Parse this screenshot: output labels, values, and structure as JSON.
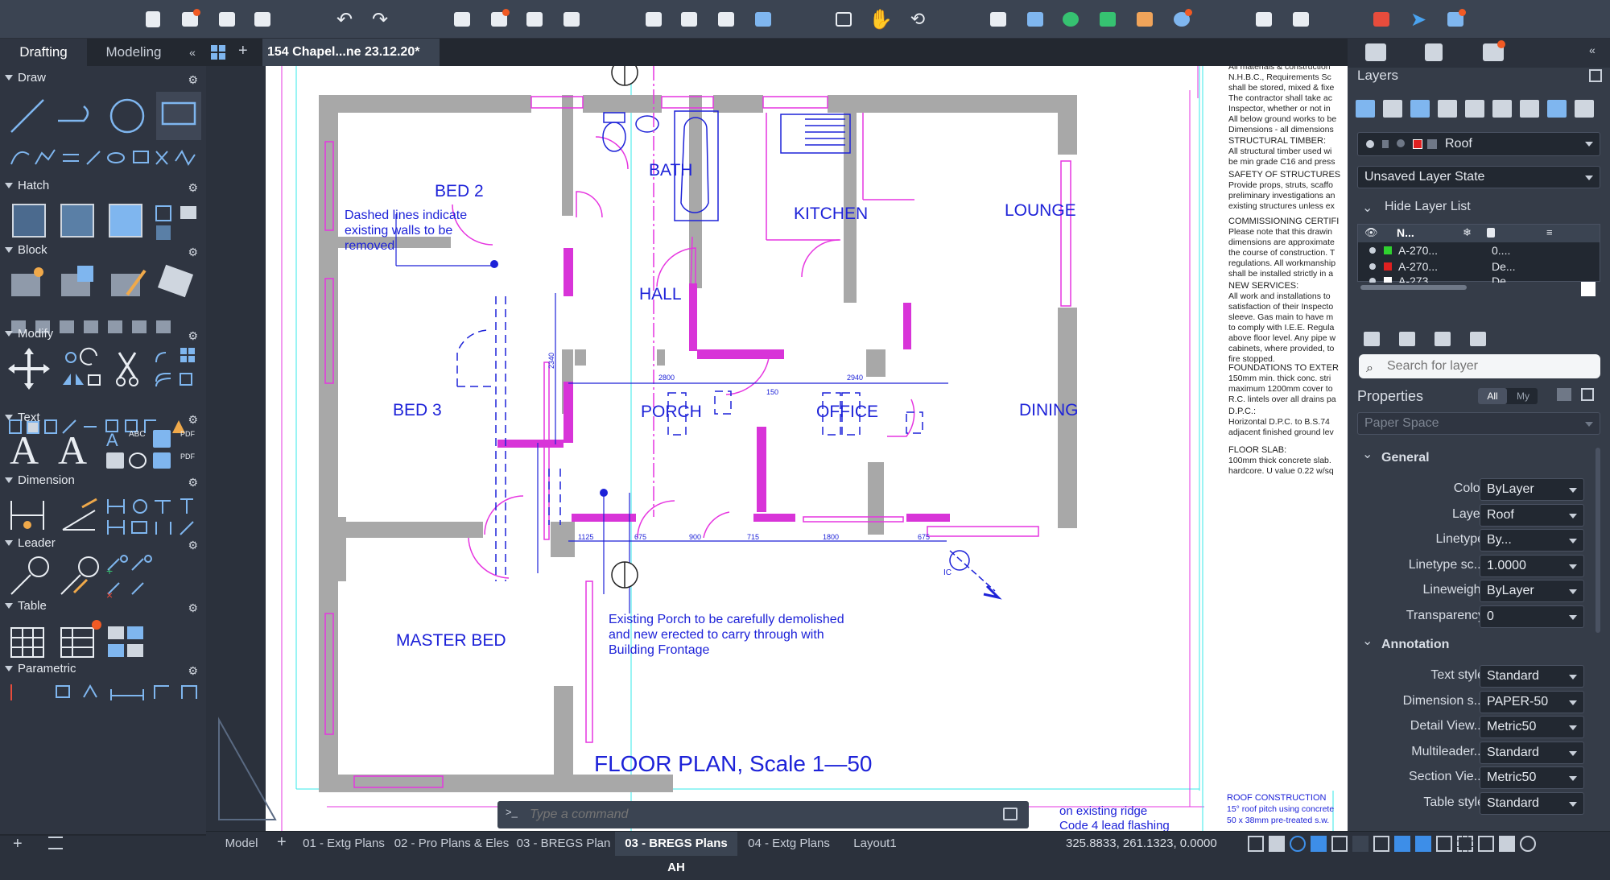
{
  "document_tab": "154 Chapel...ne 23.12.20*",
  "left_tabs": [
    "Drafting",
    "Modeling"
  ],
  "palettes": {
    "draw": "Draw",
    "hatch": "Hatch",
    "block": "Block",
    "modify": "Modify",
    "text": "Text",
    "dimension": "Dimension",
    "leader": "Leader",
    "table": "Table",
    "parametric": "Parametric"
  },
  "plan": {
    "rooms": [
      "BED 2",
      "BATH",
      "KITCHEN",
      "LOUNGE",
      "HALL",
      "BED 3",
      "PORCH",
      "OFFICE",
      "DINING",
      "MASTER BED"
    ],
    "note_dashed": [
      "Dashed lines indicate",
      "existing walls to be",
      "removed"
    ],
    "note_porch": [
      "Existing Porch to be carefully demolished",
      "and new erected to carry through with",
      "Building Frontage"
    ],
    "title": "FLOOR PLAN, Scale 1—50",
    "dims_top": [
      "2800",
      "2940",
      "150"
    ],
    "dims_bottom": [
      "1125",
      "675",
      "900",
      "715",
      "1800",
      "675"
    ],
    "dim_vertical": "2340",
    "ic_label": "IC"
  },
  "spec_notes": [
    {
      "lines": [
        "All materials & construction",
        "N.H.B.C., Requirements Sc",
        "shall be stored, mixed & fixe",
        "The contractor shall take ac",
        "Inspector, whether or not in",
        "All below ground works to be",
        "Dimensions - all dimensions"
      ]
    },
    {
      "lines": [
        "STRUCTURAL TIMBER:",
        "All structural timber used wi",
        "be min grade C16 and press"
      ]
    },
    {
      "lines": [
        "SAFETY OF STRUCTURES",
        "Provide props, struts, scaffo",
        "preliminary investigations an",
        "existing structures unless ex"
      ]
    },
    {
      "lines": [
        "COMMISSIONING CERTIFI",
        "Please note that this drawin",
        "dimensions are approximate",
        "the course of construction. T",
        "regulations. All workmanship",
        "shall be installed strictly in a"
      ]
    },
    {
      "lines": [
        "NEW SERVICES:",
        "All work and installations to",
        "satisfaction of their Inspecto",
        "sleeve. Gas main to have m",
        "to comply with I.E.E. Regula",
        "above floor level. Any pipe w",
        "cabinets, where provided, to",
        "fire stopped."
      ]
    },
    {
      "lines": [
        "FOUNDATIONS TO EXTER",
        "150mm min. thick conc. stri",
        "maximum 1200mm cover to",
        "R.C. lintels over all drains pa"
      ]
    },
    {
      "lines": [
        "D.P.C.:",
        "Horizontal D.P.C. to B.S.74",
        "adjacent finished ground lev"
      ]
    },
    {
      "lines": [
        "FLOOR SLAB:",
        "100mm thick concrete slab.",
        "hardcore. U value 0.22 w/sq"
      ]
    }
  ],
  "roof_notes": [
    "ROOF CONSTRUCTION",
    "15° roof pitch using concrete",
    "50 x 38mm pre-treated s.w."
  ],
  "bottom_notes": [
    "on existing ridge",
    "Code 4 lead flashing"
  ],
  "layers_panel": {
    "title": "Layers",
    "current_layer": "Roof",
    "layer_state": "Unsaved Layer State",
    "hide_list": "Hide Layer List",
    "col_name": "N...",
    "rows": [
      {
        "name": "A-270...",
        "desc": "0....",
        "color": "#2fd12f"
      },
      {
        "name": "A-270...",
        "desc": "De...",
        "color": "#e02020"
      },
      {
        "name": "A-273...",
        "desc": "De...",
        "color": "#ffffff"
      }
    ],
    "search_placeholder": "Search for layer"
  },
  "properties": {
    "title": "Properties",
    "filter_all": "All",
    "filter_my": "My",
    "space": "Paper Space",
    "general_label": "General",
    "general": [
      {
        "label": "Color",
        "value": "ByLayer"
      },
      {
        "label": "Layer",
        "value": "Roof"
      },
      {
        "label": "Linetype",
        "value": "By..."
      },
      {
        "label": "Linetype sc...",
        "value": "1.0000"
      },
      {
        "label": "Lineweight",
        "value": "ByLayer"
      },
      {
        "label": "Transparency",
        "value": "0"
      }
    ],
    "annotation_label": "Annotation",
    "annotation": [
      {
        "label": "Text style",
        "value": "Standard"
      },
      {
        "label": "Dimension s...",
        "value": "PAPER-50"
      },
      {
        "label": "Detail View...",
        "value": "Metric50"
      },
      {
        "label": "Multileader...",
        "value": "Standard"
      },
      {
        "label": "Section Vie...",
        "value": "Metric50"
      },
      {
        "label": "Table style",
        "value": "Standard"
      }
    ]
  },
  "command": {
    "prompt": ">_",
    "placeholder": "Type a command"
  },
  "layout_tabs": [
    "Model",
    "01 - Extg Plans",
    "02 - Pro Plans & Eles",
    "03 - BREGS Plan",
    "03 - BREGS Plans AH",
    "04 - Extg Plans",
    "Layout1"
  ],
  "active_layout": "03 - BREGS Plans AH",
  "coordinates": "325.8833, 261.1323, 0.0000",
  "colors": {
    "accent": "#3d8ee8",
    "notify": "#f15a24",
    "drawing_blue": "#1d22d8",
    "magenta": "#e635e0",
    "wall": "#a8a8a8"
  }
}
